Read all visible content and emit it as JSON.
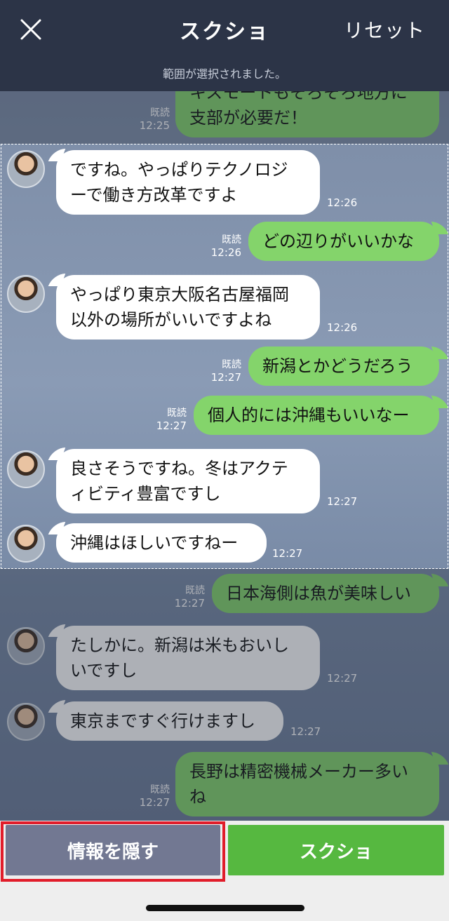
{
  "header": {
    "title": "スクショ",
    "reset_label": "リセット",
    "subtitle": "範囲が選択されました。",
    "close_icon": "close-icon"
  },
  "messages": [
    {
      "side": "right",
      "lines": [
        "キスモートもそろそろ地方に",
        "支部が必要だ！"
      ],
      "read": "既読",
      "time": "12:25"
    },
    {
      "side": "left",
      "lines": [
        "ですね。やっぱりテクノロジ",
        "ーで働き方改革ですよ"
      ],
      "time": "12:26"
    },
    {
      "side": "right",
      "lines": [
        "どの辺りがいいかな"
      ],
      "read": "既読",
      "time": "12:26"
    },
    {
      "side": "left",
      "lines": [
        "やっぱり東京大阪名古屋福岡",
        "以外の場所がいいですよね"
      ],
      "time": "12:26"
    },
    {
      "side": "right",
      "lines": [
        "新潟とかどうだろう"
      ],
      "read": "既読",
      "time": "12:27"
    },
    {
      "side": "right",
      "lines": [
        "個人的には沖縄もいいなー"
      ],
      "read": "既読",
      "time": "12:27"
    },
    {
      "side": "left",
      "lines": [
        "良さそうですね。冬はアクテ",
        "ィビティ豊富ですし"
      ],
      "time": "12:27"
    },
    {
      "side": "left",
      "lines": [
        "沖縄はほしいですねー"
      ],
      "time": "12:27"
    },
    {
      "side": "right",
      "lines": [
        "日本海側は魚が美味しい"
      ],
      "read": "既読",
      "time": "12:27"
    },
    {
      "side": "left",
      "lines": [
        "たしかに。新潟は米もおいし",
        "いですし"
      ],
      "time": "12:27"
    },
    {
      "side": "left",
      "lines": [
        "東京まですぐ行けますし"
      ],
      "time": "12:27"
    },
    {
      "side": "right",
      "lines": [
        "長野は精密機械メーカー多い",
        "ね"
      ],
      "read": "既読",
      "time": "12:27"
    }
  ],
  "footer": {
    "hide_info_label": "情報を隠す",
    "screenshot_label": "スクショ"
  },
  "colors": {
    "header_bg": "#2c3447",
    "bubble_right": "#84d46b",
    "bubble_left": "#ffffff",
    "hide_btn": "#727892",
    "shot_btn": "#56b840",
    "highlight_frame": "#e11d2a"
  }
}
